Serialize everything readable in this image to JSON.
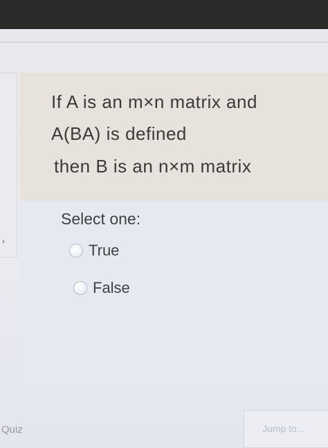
{
  "question": {
    "line1": "If A is an m×n matrix and",
    "line2": "A(BA) is defined",
    "line3": "then B is an n×m  matrix"
  },
  "answer": {
    "prompt": "Select one:",
    "options": [
      {
        "label": "True",
        "selected": false
      },
      {
        "label": "False",
        "selected": false
      }
    ]
  },
  "footer": {
    "quiz_link": "Quiz",
    "jump_placeholder": "Jump to..."
  }
}
